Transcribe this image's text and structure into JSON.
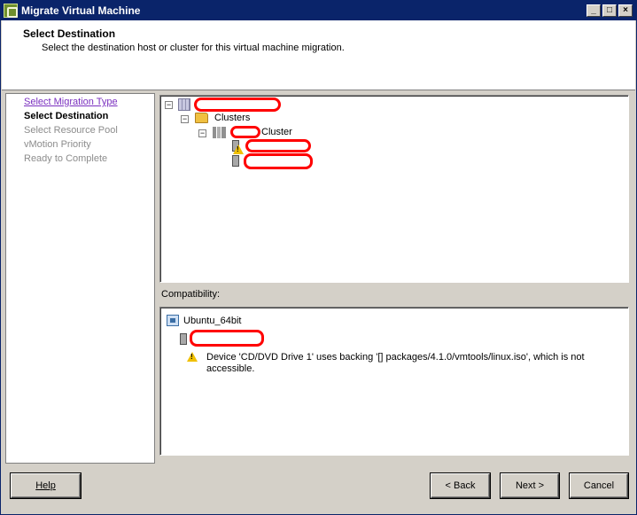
{
  "window": {
    "title": "Migrate Virtual Machine",
    "controls": {
      "minimize": "_",
      "maximize": "□",
      "close": "×"
    }
  },
  "header": {
    "title": "Select Destination",
    "subtitle": "Select the destination host or cluster for this virtual machine migration."
  },
  "steps": [
    {
      "label": "Select Migration Type",
      "state": "link"
    },
    {
      "label": "Select Destination",
      "state": "current"
    },
    {
      "label": "Select Resource Pool",
      "state": "disabled"
    },
    {
      "label": "vMotion Priority",
      "state": "disabled"
    },
    {
      "label": "Ready to Complete",
      "state": "disabled"
    }
  ],
  "tree": {
    "clusters_label": "Clusters",
    "cluster_label": "Cluster",
    "icons": [
      "datacenter-icon",
      "folder-icon",
      "cluster-icon",
      "host-warning-icon",
      "host-icon"
    ]
  },
  "compatibility": {
    "label": "Compatibility:",
    "vm_name": "Ubuntu_64bit",
    "message_line1": "Device 'CD/DVD Drive 1' uses backing '[] packages/4.1.0/vmtools/linux.iso', which is not",
    "message_line2": "accessible."
  },
  "buttons": {
    "help": "Help",
    "back": "< Back",
    "next": "Next >",
    "cancel": "Cancel"
  },
  "colors": {
    "titlebar": "#0a246a",
    "redaction": "#ff0000",
    "link": "#7a2fbf",
    "warning": "#f0c000"
  }
}
